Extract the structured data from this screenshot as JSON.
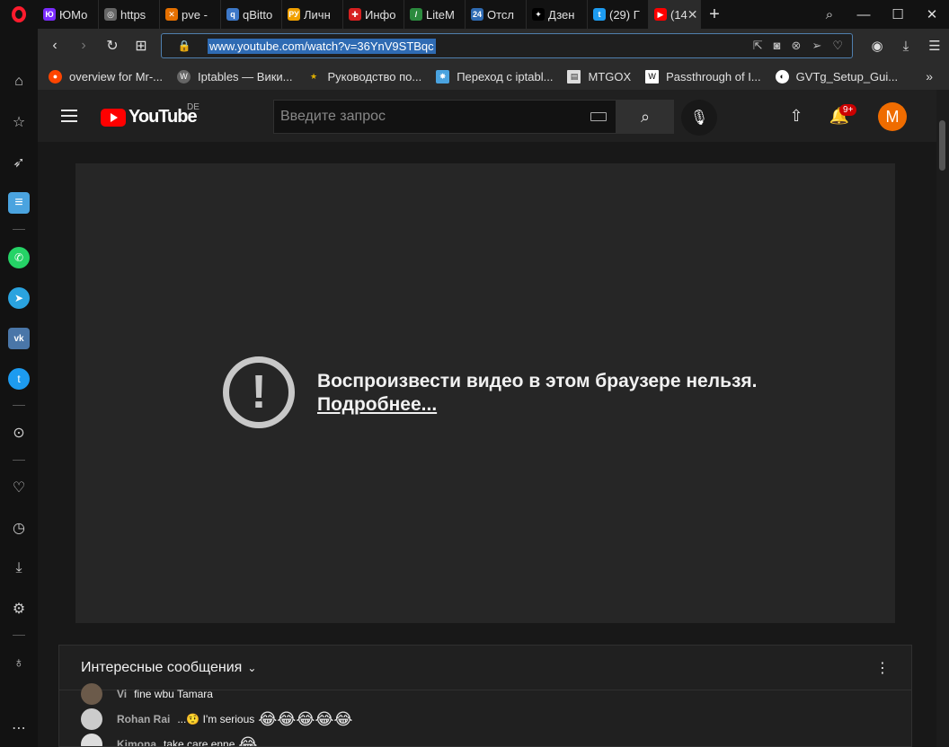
{
  "tabs": [
    {
      "title": "ЮМо",
      "icon": "yumoney-icon",
      "color": "#7b2cff"
    },
    {
      "title": "https",
      "icon": "globe-icon",
      "color": "#666666"
    },
    {
      "title": "pve - ",
      "icon": "proxmox-icon",
      "color": "#e57000"
    },
    {
      "title": "qBitto",
      "icon": "qbittorrent-icon",
      "color": "#3d78c8"
    },
    {
      "title": "Личн",
      "icon": "ru-icon",
      "color": "#f0a000"
    },
    {
      "title": "Инфо",
      "icon": "info-icon",
      "color": "#d62020"
    },
    {
      "title": "LiteM",
      "icon": "litemanager-icon",
      "color": "#2b8a3e"
    },
    {
      "title": "Отсл",
      "icon": "tracker-24-icon",
      "color": "#2f6bb3"
    },
    {
      "title": "Дзен",
      "icon": "dzen-icon",
      "color": "#000000"
    },
    {
      "title": "(29) Г",
      "icon": "twitter-icon",
      "color": "#1d9bf0"
    },
    {
      "title": "(14",
      "icon": "youtube-icon",
      "color": "#ff0000",
      "active": true
    }
  ],
  "address": {
    "url": "www.youtube.com/watch?v=36YnV9STBqc"
  },
  "bookmarks": [
    {
      "label": "overview for Mr-...",
      "icon": "reddit-icon",
      "color": "#ff4500"
    },
    {
      "label": "Iptables — Вики...",
      "icon": "wiki-icon",
      "color": "#888888"
    },
    {
      "label": "Руководство по...",
      "icon": "star-icon",
      "color": "#e0b000"
    },
    {
      "label": "Переход с iptabl...",
      "icon": "page-icon",
      "color": "#4aa3df"
    },
    {
      "label": "MTGOX",
      "icon": "document-icon",
      "color": "#dddddd"
    },
    {
      "label": "Passthrough of I...",
      "icon": "w-icon",
      "color": "#ffffff"
    },
    {
      "label": "GVTg_Setup_Gui...",
      "icon": "github-icon",
      "color": "#ffffff"
    }
  ],
  "youtube": {
    "logo_text": "YouTube",
    "region": "DE",
    "search_placeholder": "Введите запрос",
    "notifications_badge": "9+",
    "avatar_letter": "M",
    "error_message": "Воспроизвести видео в этом браузере нельзя.",
    "error_link": "Подробнее...",
    "chat_title": "Интересные сообщения"
  },
  "chat": [
    {
      "author": "Vi",
      "text": "fine wbu Tamara"
    },
    {
      "author": "Rohan Rai",
      "text": "...🤨 I'm serious",
      "emoji": "😂😂😂😂😂"
    },
    {
      "author": "Kimona",
      "text": "take care enne",
      "emoji": "😂"
    }
  ]
}
